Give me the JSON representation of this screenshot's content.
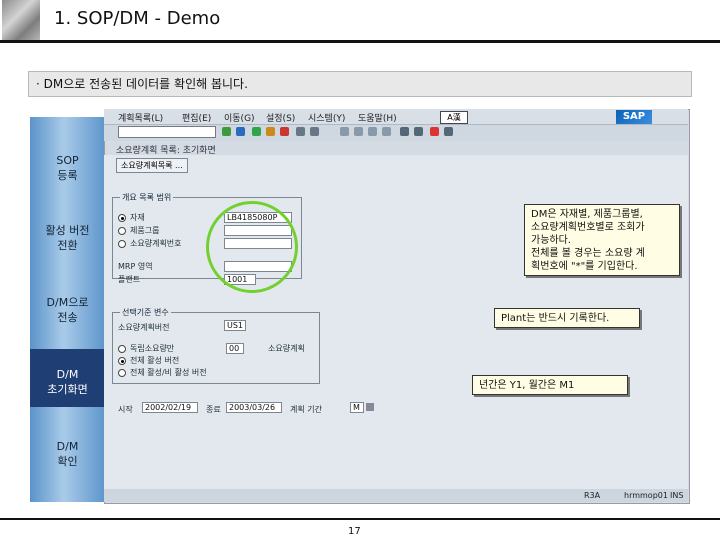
{
  "slide": {
    "title": "1. SOP/DM - Demo",
    "banner_text": "· DM으로 전송된 데이터를 확인해 봅니다.",
    "page_number": "17"
  },
  "steps": [
    {
      "label_line1": "SOP",
      "label_line2": "등록"
    },
    {
      "label_line1": "활성 버전",
      "label_line2": "전환"
    },
    {
      "label_line1": "D/M으로",
      "label_line2": "전송"
    },
    {
      "label_line1": "D/M",
      "label_line2": "초기화면"
    },
    {
      "label_line1": "D/M",
      "label_line2": "확인"
    }
  ],
  "sap": {
    "menu": [
      "계획목록(L)",
      "편집(E)",
      "이동(G)",
      "설정(S)",
      "시스템(Y)",
      "도움말(H)"
    ],
    "ime_label": "A漢",
    "logo_text": "SAP",
    "screen_title": "소요량계획 목록: 초기화면",
    "subheader": "소요량계획목록 ...",
    "group1_title": "개요 목록 범위",
    "radio_options": [
      "자재",
      "제품그룹",
      "소요량계획번호"
    ],
    "material_value": "LB4185080P",
    "plant_label": "플랜트",
    "plant_value": "1001",
    "mrp_label": "MRP 영역",
    "group2_title": "선택기준 변수",
    "version_label": "소요량계획버전",
    "version_value": "US1",
    "independent_label": "독립소요량만",
    "option_active": "전체 활성 버전",
    "option_inactive": "전체 활성/비 활성 버전",
    "unit_value": "00",
    "unit_label": "소요량계획",
    "from_label": "시작",
    "from_value": "2002/02/19",
    "to_label": "종료",
    "to_value": "2003/03/26",
    "period_label": "계획 기간",
    "period_value": "M",
    "status_text_1": "R3A",
    "status_text_2": "hrmmop01",
    "status_text_3": "INS"
  },
  "callouts": {
    "dm_search": [
      "DM은 자재별, 제품그룹별,",
      "소요량계획번호별로 조회가",
      "가능하다.",
      "전체를 볼 경우는 소요량 계",
      "획번호에 \"*\"를 기입한다."
    ],
    "plant_required": "Plant는 반드시 기록한다.",
    "period_format": "년간은 Y1, 월간은 M1"
  }
}
